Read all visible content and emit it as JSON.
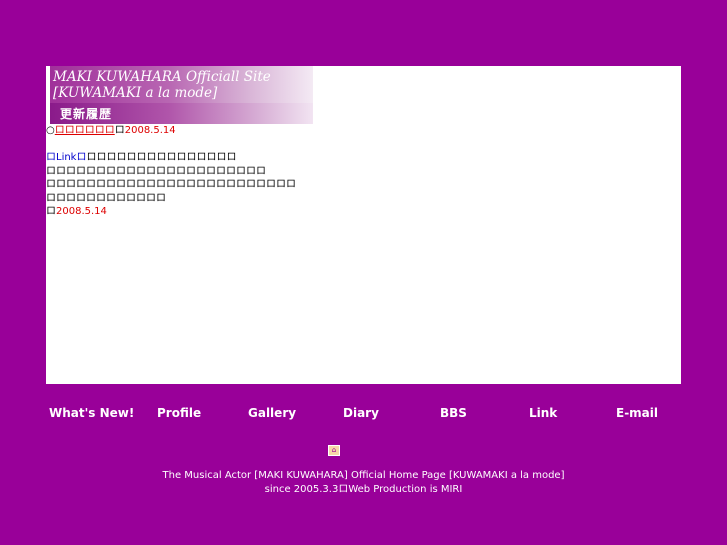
{
  "banner": {
    "title_line1": "MAKI KUWAHARA Officiall Site",
    "title_line2": "[KUWAMAKI a la mode]",
    "section_title": "更新履歴"
  },
  "entries": [
    {
      "bullet": "○",
      "title": "ロロロロロロ",
      "sep": "ロ",
      "date": "2008.5.14"
    },
    {
      "tag": "ロLinkロ",
      "line1_rest": "ロロロロロロロロロロロロロロロ",
      "line2": "ロロロロロロロロロロロロロロロロロロロロロロ",
      "line3": "ロロロロロロロロロロロロロロロロロロロロロロロロロ",
      "line4": "ロロロロロロロロロロロロ",
      "date_prefix": "ロ",
      "date": "2008.5.14"
    }
  ],
  "nav": [
    {
      "label": "What's New!"
    },
    {
      "label": "Profile"
    },
    {
      "label": "Gallery"
    },
    {
      "label": "Diary"
    },
    {
      "label": "BBS"
    },
    {
      "label": "Link"
    },
    {
      "label": "E-mail"
    }
  ],
  "home_icon": "home-icon",
  "footer": {
    "line1": "The Musical Actor [MAKI KUWAHARA] Official Home Page [KUWAMAKI a la mode]",
    "line2": "since 2005.3.3ロWeb Production is MIRI"
  },
  "colors": {
    "background": "#990099",
    "date_red": "#dd0000",
    "link_blue": "#0000cc"
  }
}
